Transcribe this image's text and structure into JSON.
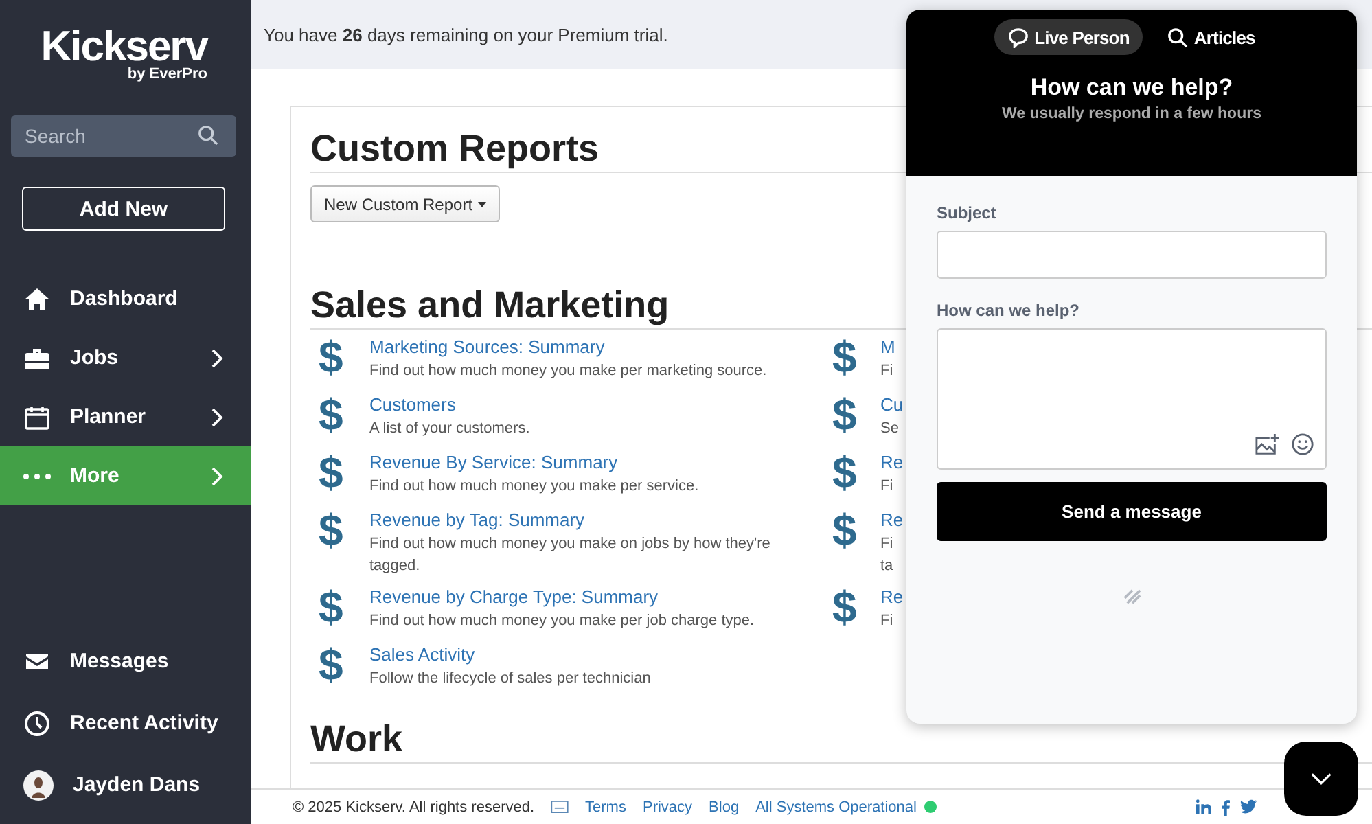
{
  "sidebar": {
    "logo": "Kickserv",
    "logo_sub": "by EverPro",
    "search": {
      "placeholder": "Search"
    },
    "add_button": "Add New",
    "items": [
      {
        "label": "Dashboard",
        "chevron": false,
        "selected": false
      },
      {
        "label": "Jobs",
        "chevron": true,
        "selected": false
      },
      {
        "label": "Planner",
        "chevron": true,
        "selected": false
      },
      {
        "label": "More",
        "chevron": true,
        "selected": true
      }
    ],
    "bottom_items": [
      {
        "label": "Messages"
      },
      {
        "label": "Recent Activity"
      },
      {
        "label": "Jayden Dans"
      }
    ]
  },
  "banner": "You have **26** days remaining on your Premium trial.",
  "page": {
    "title": "Custom Reports",
    "new_button": "New Custom Report",
    "sections": [
      {
        "title": "Sales and Marketing",
        "left": [
          {
            "icon": "$",
            "title": "Marketing Sources: Summary",
            "desc": "Find out how much money you make per marketing source."
          },
          {
            "icon": "$",
            "title": "Customers",
            "desc": "A list of your customers."
          },
          {
            "icon": "$",
            "title": "Revenue By Service: Summary",
            "desc": "Find out how much money you make per service."
          },
          {
            "icon": "$",
            "title": "Revenue by Tag: Summary",
            "desc": "Find out how much money you make on jobs by how they're tagged."
          },
          {
            "icon": "$",
            "title": "Revenue by Charge Type: Summary",
            "desc": "Find out how much money you make per job charge type."
          },
          {
            "icon": "$",
            "title": "Sales Activity",
            "desc": "Follow the lifecycle of sales per technician"
          }
        ],
        "right": [
          {
            "icon": "$",
            "title": "M",
            "desc": "Fi"
          },
          {
            "icon": "$",
            "title": "Cu",
            "desc": "Se"
          },
          {
            "icon": "$",
            "title": "Re",
            "desc": "Fi"
          },
          {
            "icon": "$",
            "title": "Re",
            "desc": "Fi ta"
          },
          {
            "icon": "$",
            "title": "Re",
            "desc": "Fi"
          }
        ]
      },
      {
        "title": "Work"
      }
    ]
  },
  "footer": {
    "copyright": "© 2025 Kickserv. All rights reserved.",
    "links": [
      "Terms",
      "Privacy",
      "Blog",
      "All Systems Operational"
    ]
  },
  "chat": {
    "tabs": [
      {
        "label": "Live Person",
        "selected": true
      },
      {
        "label": "Articles",
        "selected": false
      }
    ],
    "title": "How can we help?",
    "subtitle": "We usually respond in a few hours",
    "subject_label": "Subject",
    "message_label": "How can we help?",
    "send_button": "Send a message"
  }
}
